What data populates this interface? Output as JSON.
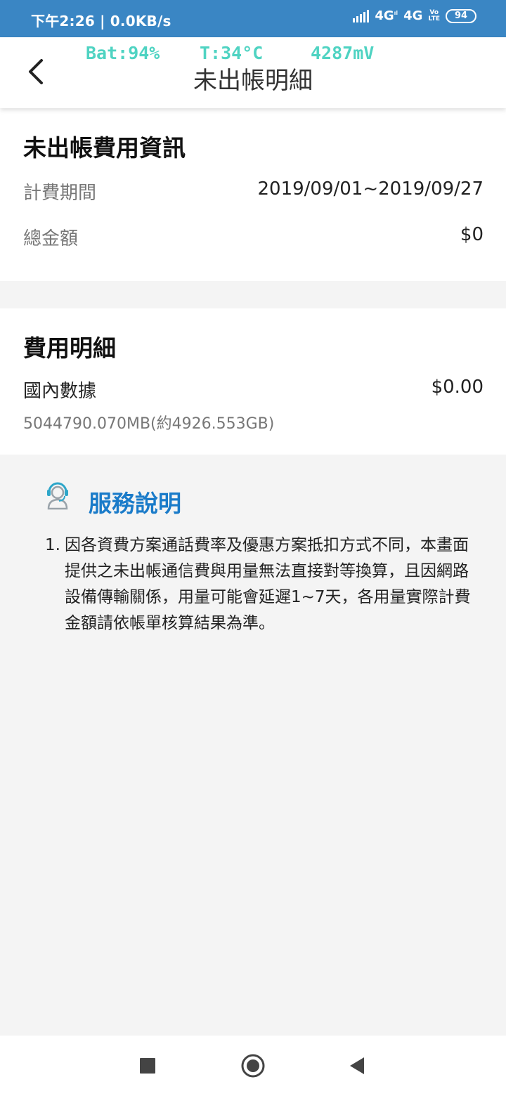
{
  "status_bar": {
    "time": "下午2:26",
    "speed": "0.0KB/s",
    "network_1": "4G",
    "network_2": "4G",
    "volte_top": "Vo",
    "volte_bottom": "LTE",
    "battery": "94"
  },
  "overlay": {
    "battery": "Bat:94%",
    "temperature": "T:34°C",
    "voltage": "4287mV"
  },
  "header": {
    "title": "未出帳明細",
    "back_icon": "chevron-left-icon"
  },
  "unbilled_info": {
    "title": "未出帳費用資訊",
    "rows": [
      {
        "label": "計費期間",
        "value": "2019/09/01~2019/09/27"
      },
      {
        "label": "總金額",
        "value": "$0"
      }
    ]
  },
  "fee_details": {
    "title": "費用明細",
    "item_name": "國內數據",
    "item_amount": "$0.00",
    "item_usage": "5044790.070MB(約4926.553GB)"
  },
  "service": {
    "title": "服務說明",
    "icon": "customer-service-icon",
    "notes": [
      {
        "num": "1.",
        "text": "因各資費方案通話費率及優惠方案抵扣方式不同，本畫面提供之未出帳通信費與用量無法直接對等換算，且因網路設備傳輸關係，用量可能會延遲1~7天，各用量實際計費金額請依帳單核算結果為準。"
      }
    ]
  },
  "colors": {
    "status_bar": "#3a86c4",
    "accent": "#1a7bc9",
    "overlay_text": "#4fd3c2"
  }
}
